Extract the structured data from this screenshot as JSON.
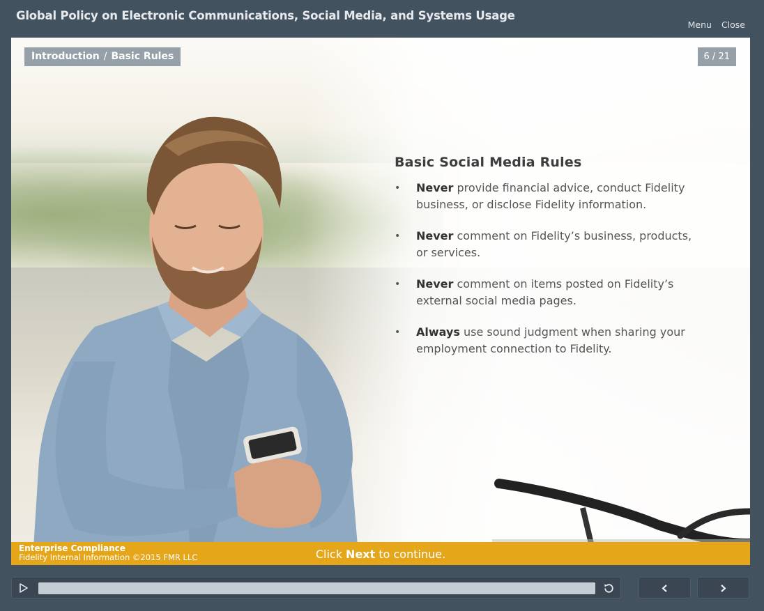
{
  "window": {
    "title": "Global Policy on Electronic Communications, Social Media, and Systems Usage",
    "menu_label": "Menu",
    "close_label": "Close"
  },
  "slide": {
    "breadcrumb": {
      "section": "Introduction",
      "separator": "/",
      "page": "Basic Rules"
    },
    "page_counter": "6 / 21",
    "heading": "Basic Social Media Rules",
    "bullets": [
      {
        "emphasis": "Never",
        "text": " provide financial advice, conduct Fidelity business, or disclose Fidelity information."
      },
      {
        "emphasis": "Never",
        "text": " comment on Fidelity’s business, products, or services."
      },
      {
        "emphasis": "Never",
        "text": " comment on items posted on Fidelity’s external social media pages."
      },
      {
        "emphasis": "Always",
        "text": " use sound judgment when sharing your employment connection to Fidelity."
      }
    ]
  },
  "footer": {
    "org": "Enterprise Compliance",
    "copyright": "Fidelity Internal Information ©2015 FMR LLC",
    "cta_prefix": "Click ",
    "cta_emphasis": "Next",
    "cta_suffix": " to continue."
  },
  "player": {
    "progress": 1.0,
    "icons": {
      "play": "play-icon",
      "replay": "replay-icon",
      "prev": "chevron-left-icon",
      "next": "chevron-right-icon"
    }
  },
  "colors": {
    "chrome": "#43525f",
    "footer_accent": "#e5a719",
    "badge": "#95a0a9"
  }
}
